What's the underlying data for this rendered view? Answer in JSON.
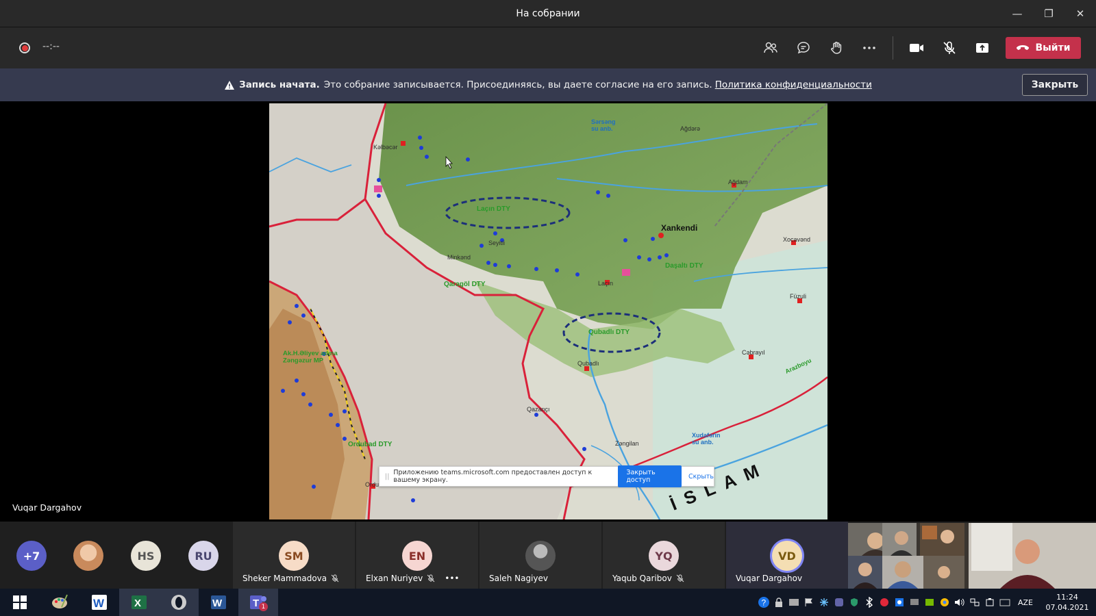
{
  "window": {
    "title": "На собрании",
    "minimize": "—",
    "restore": "❐",
    "close": "✕"
  },
  "toolbar": {
    "timer": "--:--",
    "leave_label": "Выйти"
  },
  "banner": {
    "title": "Запись начата.",
    "text": "Это собрание записывается. Присоединяясь, вы даете согласие на его запись.",
    "link": "Политика конфиденциальности",
    "close_label": "Закрыть"
  },
  "stage": {
    "presenter_name": "Vuqar Dargahov",
    "map_labels": {
      "xankendi": "Xankendi",
      "lacin_dty": "Laçın DTY",
      "qubadli_dty": "Qubadlı DTY",
      "qaragol_dty": "Qaragöl DTY",
      "dasalti_dty": "Daşaltı DTY",
      "ordubad_dty": "Ordubad DTY",
      "zangezur": "Ak.H.Əliyev adına\nZəngəzur MP",
      "agdam": "Ağdam",
      "xocavend": "Xocavənd",
      "fuzuli": "Füzuli",
      "cebrayil": "Cəbrayıl",
      "qubadli": "Qubadlı",
      "lacin": "Laçın",
      "zengilan": "Zəngilan",
      "kelbecer": "Kəlbəcər",
      "qazanci": "Qazançı",
      "xudaferin": "Xudafərin\nsu anb.",
      "sarsang": "Sərsəng\nsu anb.",
      "islam": "İSLAM",
      "agdere": "Ağdərə",
      "seyitli": "Seyitli",
      "minkend": "Minkənd",
      "ordubad": "Ordubad",
      "araz": "Arazboyu"
    },
    "share_notice": {
      "text": "Приложению teams.microsoft.com предоставлен доступ к вашему экрану.",
      "stop_label": "Закрыть доступ",
      "hide_label": "Скрыть"
    }
  },
  "roster": {
    "overflow": "+7",
    "participants": [
      {
        "initials": "HS",
        "color": "#e8e4d8"
      },
      {
        "initials": "RU",
        "color": "#d9d6ea"
      },
      {
        "initials": "SM",
        "name": "Sheker Mammadova",
        "color": "#f7dcc7"
      },
      {
        "initials": "EN",
        "name": "Elxan Nuriyev",
        "color": "#f6d6d2"
      },
      {
        "name": "Saleh Nagiyev"
      },
      {
        "initials": "YQ",
        "name": "Yaqub Qaribov",
        "color": "#ead8dc"
      },
      {
        "initials": "VD",
        "name": "Vuqar Dargahov",
        "color": "#f4deb3"
      }
    ]
  },
  "taskbar": {
    "lang": "AZE",
    "time": "11:24",
    "date": "07.04.2021",
    "teams_badge": "1"
  }
}
